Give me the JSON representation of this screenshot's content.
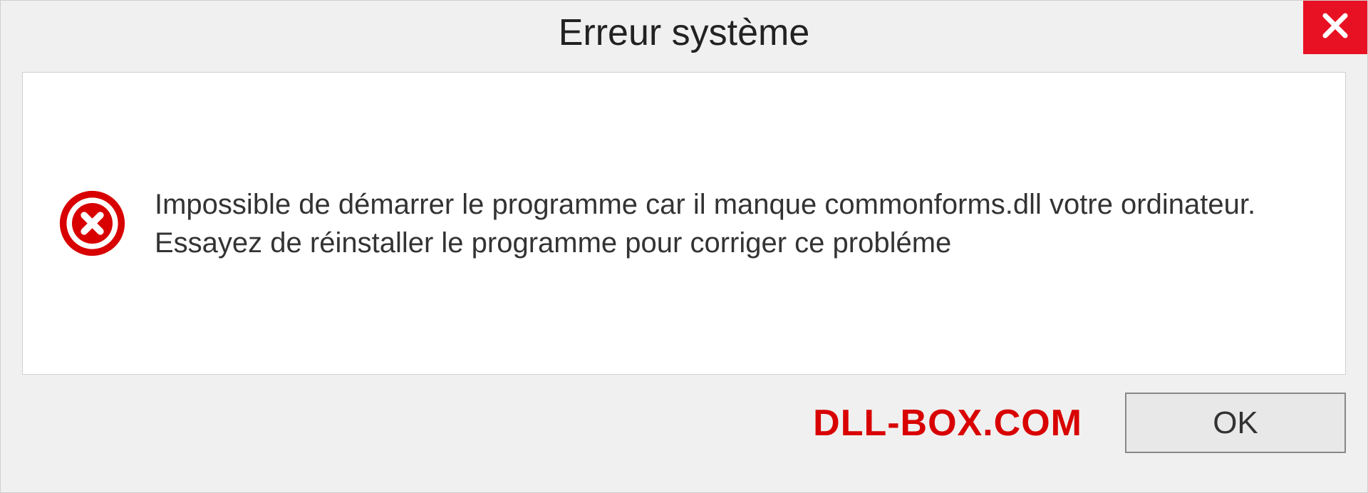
{
  "dialog": {
    "title": "Erreur système",
    "message": "Impossible de démarrer le programme car il manque commonforms.dll votre ordinateur. Essayez de réinstaller le programme pour corriger ce probléme",
    "ok_label": "OK",
    "branding": "DLL-BOX.COM"
  },
  "colors": {
    "close_bg": "#e81123",
    "error_red": "#d80000",
    "branding_red": "#d80000"
  }
}
